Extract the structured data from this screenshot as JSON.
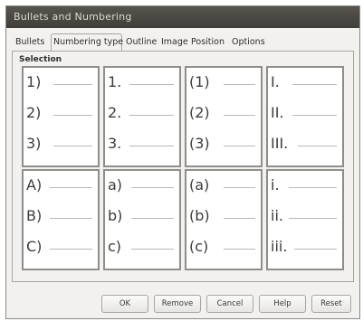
{
  "window": {
    "title": "Bullets and Numbering"
  },
  "tabs": [
    {
      "label": "Bullets"
    },
    {
      "label": "Numbering type"
    },
    {
      "label": "Outline"
    },
    {
      "label": "Image"
    },
    {
      "label": "Position"
    },
    {
      "label": "Options"
    }
  ],
  "active_tab": "Numbering type",
  "selection": {
    "label": "Selection"
  },
  "presets": [
    {
      "items": [
        "1)",
        "2)",
        "3)"
      ]
    },
    {
      "items": [
        "1.",
        "2.",
        "3."
      ]
    },
    {
      "items": [
        "(1)",
        "(2)",
        "(3)"
      ]
    },
    {
      "items": [
        "I.",
        "II.",
        "III."
      ]
    },
    {
      "items": [
        "A)",
        "B)",
        "C)"
      ]
    },
    {
      "items": [
        "a)",
        "b)",
        "c)"
      ]
    },
    {
      "items": [
        "(a)",
        "(b)",
        "(c)"
      ]
    },
    {
      "items": [
        "i.",
        "ii.",
        "iii."
      ]
    }
  ],
  "buttons": {
    "ok": "OK",
    "remove": "Remove",
    "cancel": "Cancel",
    "help": "Help",
    "reset": "Reset"
  }
}
